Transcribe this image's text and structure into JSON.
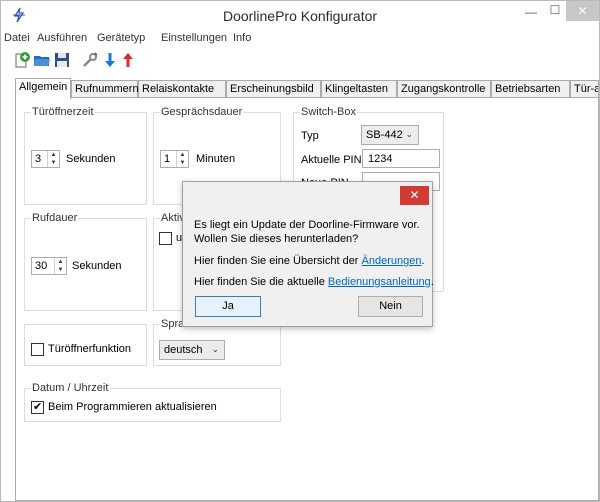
{
  "window": {
    "title": "DoorlinePro Konfigurator"
  },
  "menu": [
    "Datei",
    "Ausführen",
    "Gerätetyp",
    "Einstellungen",
    "Info"
  ],
  "toolbar": {
    "icons": [
      "add-document-icon",
      "open-folder-icon",
      "save-icon",
      "tools-icon",
      "download-arrow-icon",
      "upload-arrow-icon"
    ],
    "colors": {
      "add": "#3a9c3a",
      "folder": "#1f6fbf",
      "down": "#1e78d8",
      "up": "#d92b2b"
    }
  },
  "tabs": [
    "Allgemein",
    "Rufnummern",
    "Relaiskontakte",
    "Erscheinungsbild",
    "Klingeltasten",
    "Zugangskontrolle",
    "Betriebsarten",
    "Tür-auf-Taste"
  ],
  "general": {
    "door_open_time": {
      "title": "Türöffnerzeit",
      "value": "3",
      "unit": "Sekunden"
    },
    "call_duration": {
      "title": "Gesprächsdauer",
      "value": "1",
      "unit": "Minuten"
    },
    "ring_duration": {
      "title": "Rufdauer",
      "value": "30",
      "unit": "Sekunden"
    },
    "active": {
      "title": "Aktiv",
      "checkbox_label": "ur"
    },
    "switch_box": {
      "title": "Switch-Box",
      "type_label": "Typ",
      "type_value": "SB-442",
      "current_pin_label": "Aktuelle PIN",
      "current_pin_value": "1234",
      "new_pin_label": "Neue PIN",
      "new_pin_value": ""
    },
    "door_opener_function": {
      "label": "Türöffnerfunktion",
      "checked": false
    },
    "language": {
      "title": "Sprache",
      "value": "deutsch"
    },
    "datetime": {
      "title": "Datum / Uhrzeit",
      "checkbox_label": "Beim Programmieren aktualisieren",
      "checked": true
    }
  },
  "dialog": {
    "line1": "Es liegt ein Update der Doorline-Firmware vor.",
    "line2": "Wollen Sie dieses herunterladen?",
    "changes_prefix": "Hier finden Sie eine Übersicht der ",
    "changes_link": "Änderungen",
    "changes_suffix": ".",
    "manual_prefix": "Hier finden Sie die aktuelle ",
    "manual_link": "Bedienungsanleitung",
    "manual_suffix": ".",
    "yes_label": "Ja",
    "no_label": "Nein",
    "close_color": "#d23b33"
  }
}
